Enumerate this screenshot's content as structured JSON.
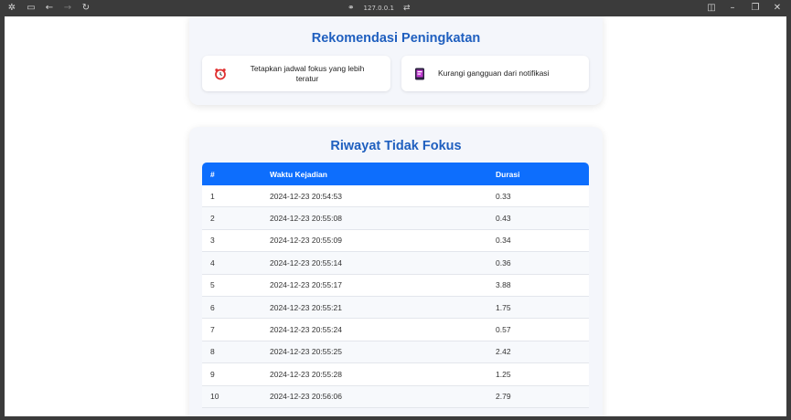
{
  "browser": {
    "url": "127.0.0.1",
    "icons": [
      "extensions-icon",
      "sidebar-icon",
      "back-icon",
      "forward-icon",
      "reload-icon",
      "link-icon",
      "translate-icon",
      "split-view-icon",
      "minimize-icon",
      "restore-icon",
      "close-icon"
    ]
  },
  "recommendations": {
    "title": "Rekomendasi Peningkatan",
    "items": [
      {
        "icon": "alarm-clock-icon",
        "text": "Tetapkan jadwal fokus yang lebih teratur"
      },
      {
        "icon": "phone-notification-icon",
        "text": "Kurangi gangguan dari notifikasi"
      }
    ]
  },
  "history": {
    "title": "Riwayat Tidak Fokus",
    "columns": [
      "#",
      "Waktu Kejadian",
      "Durasi"
    ],
    "rows": [
      {
        "no": "1",
        "time": "2024-12-23 20:54:53",
        "duration": "0.33"
      },
      {
        "no": "2",
        "time": "2024-12-23 20:55:08",
        "duration": "0.43"
      },
      {
        "no": "3",
        "time": "2024-12-23 20:55:09",
        "duration": "0.34"
      },
      {
        "no": "4",
        "time": "2024-12-23 20:55:14",
        "duration": "0.36"
      },
      {
        "no": "5",
        "time": "2024-12-23 20:55:17",
        "duration": "3.88"
      },
      {
        "no": "6",
        "time": "2024-12-23 20:55:21",
        "duration": "1.75"
      },
      {
        "no": "7",
        "time": "2024-12-23 20:55:24",
        "duration": "0.57"
      },
      {
        "no": "8",
        "time": "2024-12-23 20:55:25",
        "duration": "2.42"
      },
      {
        "no": "9",
        "time": "2024-12-23 20:55:28",
        "duration": "1.25"
      },
      {
        "no": "10",
        "time": "2024-12-23 20:56:06",
        "duration": "2.79"
      }
    ]
  },
  "colors": {
    "title_blue": "#1f5fbf",
    "header_blue": "#0d6efd"
  }
}
